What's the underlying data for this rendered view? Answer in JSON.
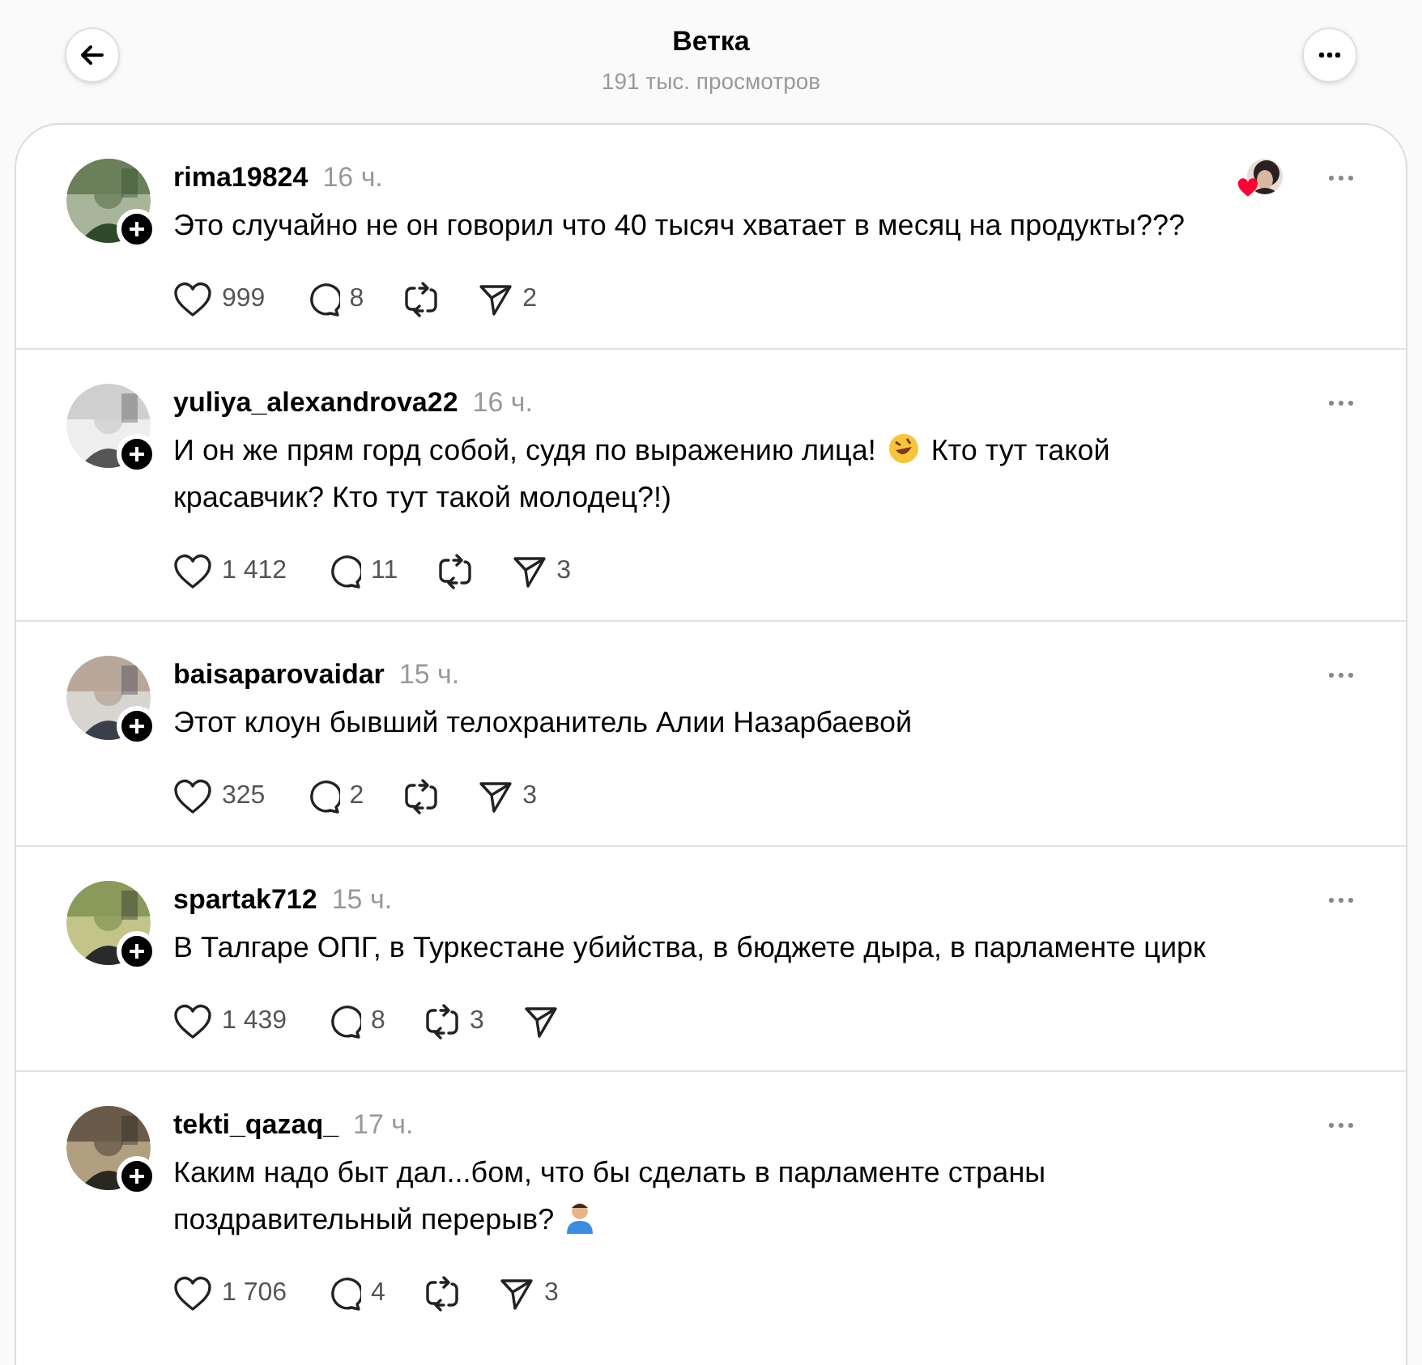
{
  "header": {
    "title": "Ветка",
    "subtitle": "191 тыс. просмотров"
  },
  "posts": [
    {
      "username": "rima19824",
      "time": "16 ч.",
      "author_liked": true,
      "body": [
        {
          "kind": "text",
          "text": "Это случайно не он говорил что 40 тысяч хватает в месяц на продукты???"
        }
      ],
      "likes": "999",
      "replies": "8",
      "shares": "2"
    },
    {
      "username": "yuliya_alexandrova22",
      "time": "16 ч.",
      "body": [
        {
          "kind": "text",
          "text": "И он же прям горд собой, судя по выражению лица! "
        },
        {
          "kind": "laugh"
        },
        {
          "kind": "text",
          "text": " Кто тут такой красавчик? Кто тут такой молодец?!)"
        }
      ],
      "likes": "1 412",
      "replies": "11",
      "shares": "3"
    },
    {
      "username": "baisaparovaidar",
      "time": "15 ч.",
      "body": [
        {
          "kind": "text",
          "text": "Этот клоун бывший телохранитель Алии Назарбаевой"
        }
      ],
      "likes": "325",
      "replies": "2",
      "shares": "3"
    },
    {
      "username": "spartak712",
      "time": "15 ч.",
      "body": [
        {
          "kind": "text",
          "text": "В Талгаре ОПГ, в Туркестане убийства, в бюджете дыра, в парламенте цирк"
        }
      ],
      "likes": "1 439",
      "replies": "8",
      "reposts": "3"
    },
    {
      "username": "tekti_qazaq_",
      "time": "17 ч.",
      "body": [
        {
          "kind": "text",
          "text": "Каким надо быт дал...бом, что бы сделать в парламенте страны поздравительный перерыв? "
        },
        {
          "kind": "person"
        }
      ],
      "likes": "1 706",
      "replies": "4",
      "shares": "3"
    }
  ]
}
